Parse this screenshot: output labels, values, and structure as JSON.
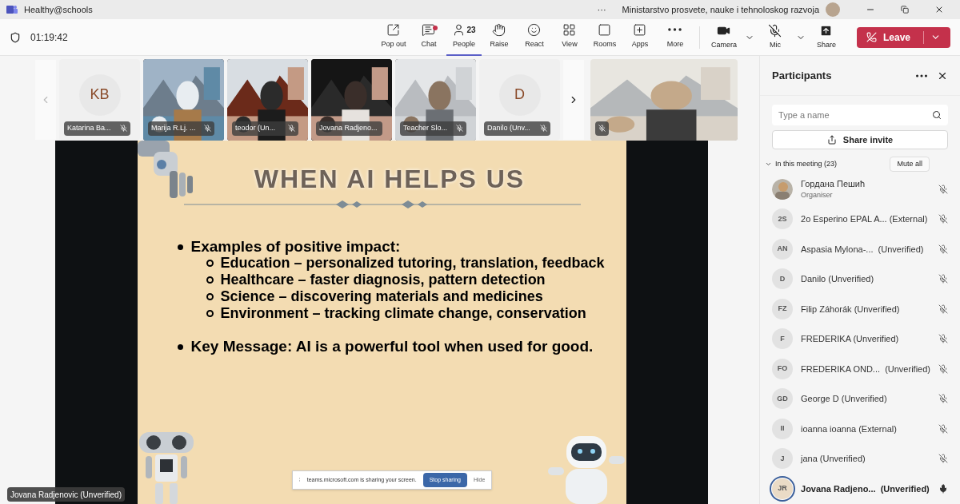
{
  "window": {
    "title": "Healthy@schools",
    "account": "Ministarstvo prosvete, nauke i tehnoloskog razvoja",
    "more": "···"
  },
  "meeting": {
    "timer": "01:19:42"
  },
  "toolbar": [
    {
      "kind": "popout",
      "label": "Pop out",
      "selected": false
    },
    {
      "kind": "chat",
      "label": "Chat",
      "selected": false,
      "notification": true
    },
    {
      "kind": "people",
      "label": "People",
      "selected": true,
      "count": "23"
    },
    {
      "kind": "raise",
      "label": "Raise",
      "selected": false
    },
    {
      "kind": "react",
      "label": "React",
      "selected": false
    },
    {
      "kind": "view",
      "label": "View",
      "selected": false
    },
    {
      "kind": "rooms",
      "label": "Rooms",
      "selected": false
    },
    {
      "kind": "apps",
      "label": "Apps",
      "selected": false
    },
    {
      "kind": "more",
      "label": "More",
      "selected": false
    }
  ],
  "devices": [
    {
      "kind": "camera",
      "label": "Camera",
      "dropdown": true
    },
    {
      "kind": "mic",
      "label": "Mic",
      "dropdown": true
    },
    {
      "kind": "share",
      "label": "Share",
      "dropdown": false
    }
  ],
  "leave": {
    "label": "Leave"
  },
  "video_strip": [
    {
      "kind": "avatar",
      "initials": "KB",
      "name": "Katarina Ba...",
      "muted": true
    },
    {
      "kind": "mountains",
      "name": "Marija R.Lj. ...",
      "muted": true
    },
    {
      "kind": "room",
      "name": "teodor (Un...",
      "muted": true
    },
    {
      "kind": "dark",
      "name": "Jovana Radjeno...",
      "muted": false
    },
    {
      "kind": "classroom",
      "name": "Teacher Slo...",
      "muted": true
    },
    {
      "kind": "avatar",
      "initials": "D",
      "name": "Danilo (Unv...",
      "muted": true
    }
  ],
  "featured_video": {
    "muted": true
  },
  "slide": {
    "title": "WHEN AI HELPS US",
    "bullets": [
      {
        "text": "Examples of positive impact:",
        "children": [
          {
            "text": "Education – personalized tutoring, translation, feedback"
          },
          {
            "text": "Healthcare – faster diagnosis, pattern detection"
          },
          {
            "text": "Science – discovering materials and medicines"
          },
          {
            "text": "Environment – tracking climate change, conservation"
          }
        ]
      },
      {
        "text": "Key Message: AI is a powerful tool when used for good."
      }
    ]
  },
  "presenter_label": "Jovana Radjenovic (Unverified)",
  "share_bar": {
    "grip": "⁞",
    "message": "teams.microsoft.com is sharing your screen.",
    "stop": "Stop sharing",
    "hide": "Hide"
  },
  "participants": {
    "title": "Participants",
    "search": {
      "placeholder": "Type a name"
    },
    "share_invite": "Share invite",
    "section": "In this meeting (23)",
    "mute_all": "Mute all",
    "people": [
      {
        "name": "Гордана Пешић",
        "role": "Organiser",
        "muted": true,
        "speaking": false
      },
      {
        "kind": "initials",
        "initials": "2S",
        "name": "2o Esperino EPAL A... (External)",
        "muted": true,
        "speaking": false
      },
      {
        "kind": "initials",
        "initials": "AN",
        "name": "Aspasia Mylona-...  (Unverified)",
        "muted": true,
        "speaking": false
      },
      {
        "kind": "initials",
        "initials": "D",
        "name": "Danilo (Unverified)",
        "muted": true,
        "speaking": false
      },
      {
        "kind": "initials",
        "initials": "FZ",
        "name": "Filip Záhorák (Unverified)",
        "muted": true,
        "speaking": false
      },
      {
        "kind": "initials",
        "initials": "F",
        "name": "FREDERIKA (Unverified)",
        "muted": true,
        "speaking": false
      },
      {
        "kind": "initials",
        "initials": "FO",
        "name": "FREDERIKA OND...  (Unverified)",
        "muted": true,
        "speaking": false
      },
      {
        "kind": "initials",
        "initials": "GD",
        "name": "George D (Unverified)",
        "muted": true,
        "speaking": false
      },
      {
        "kind": "initials",
        "initials": "II",
        "name": "ioanna ioanna (External)",
        "muted": true,
        "speaking": false
      },
      {
        "kind": "initials",
        "initials": "J",
        "name": "jana (Unverified)",
        "muted": true,
        "speaking": false
      },
      {
        "kind": "initials",
        "initials": "JR",
        "name": "Jovana Radjeno...  (Unverified)",
        "muted": false,
        "speaking": true
      }
    ]
  }
}
